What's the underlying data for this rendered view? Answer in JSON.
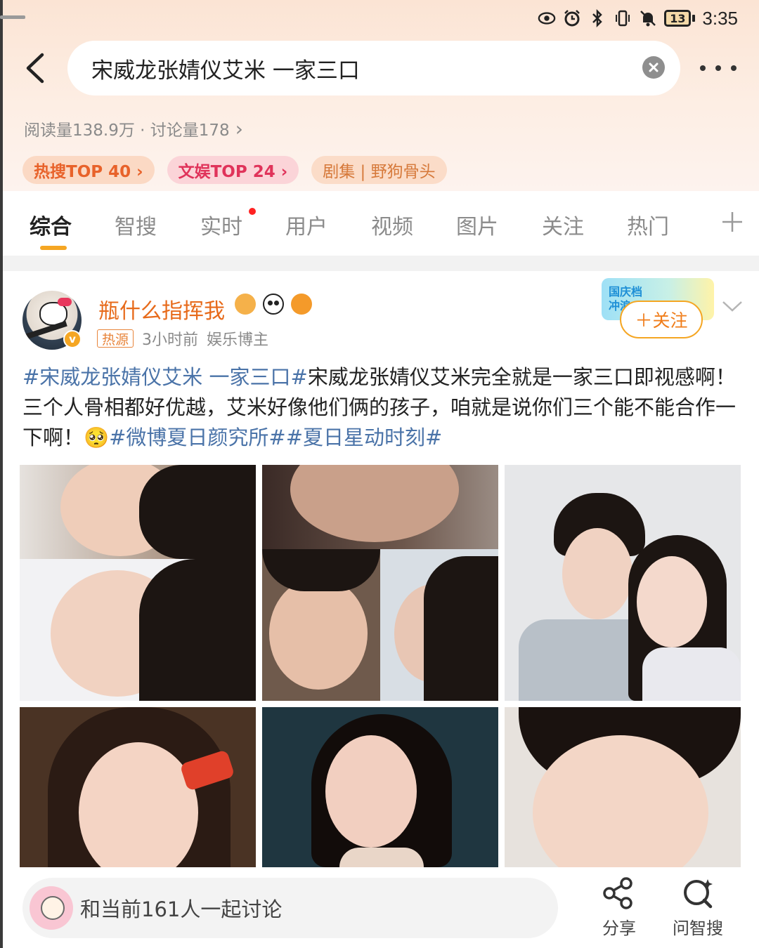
{
  "status_bar": {
    "battery": "13",
    "time": "3:35"
  },
  "search": {
    "query": "宋威龙张婧仪艾米 一家三口"
  },
  "stats": {
    "text": "阅读量138.9万 · 讨论量178",
    "arrow": "›"
  },
  "tags": [
    {
      "label": "热搜TOP 40 ›"
    },
    {
      "label": "文娱TOP 24 ›"
    },
    {
      "label": "剧集 | 野狗骨头"
    }
  ],
  "tabs": [
    {
      "label": "综合"
    },
    {
      "label": "智搜"
    },
    {
      "label": "实时"
    },
    {
      "label": "用户"
    },
    {
      "label": "视频"
    },
    {
      "label": "图片"
    },
    {
      "label": "关注"
    },
    {
      "label": "热门"
    }
  ],
  "post": {
    "user_name": "瓶什么指挥我",
    "source_badge": "热源",
    "time": "3小时前",
    "user_type": "娱乐博主",
    "follow_label": "＋关注",
    "promo_text": "国庆档\n冲浪",
    "text_parts": [
      {
        "text": "#宋威龙张婧仪艾米 一家三口#",
        "hashtag": true
      },
      {
        "text": "宋威龙张婧仪艾米完全就是一家三口即视感啊！三个人骨相都好优越，艾米好像他们俩的孩子，咱就是说你们三个能不能合作一下啊！🥺",
        "hashtag": false
      },
      {
        "text": "#微博夏日颜究所#",
        "hashtag": true
      },
      {
        "text": "#夏日星动时刻#",
        "hashtag": true
      }
    ]
  },
  "bottom_bar": {
    "discuss_text": "和当前161人一起讨论",
    "share_label": "分享",
    "ask_label": "问智搜"
  },
  "colors": {
    "accent_orange": "#f5a623",
    "hashtag_blue": "#4a73a8",
    "username_orange": "#e76a1a"
  }
}
